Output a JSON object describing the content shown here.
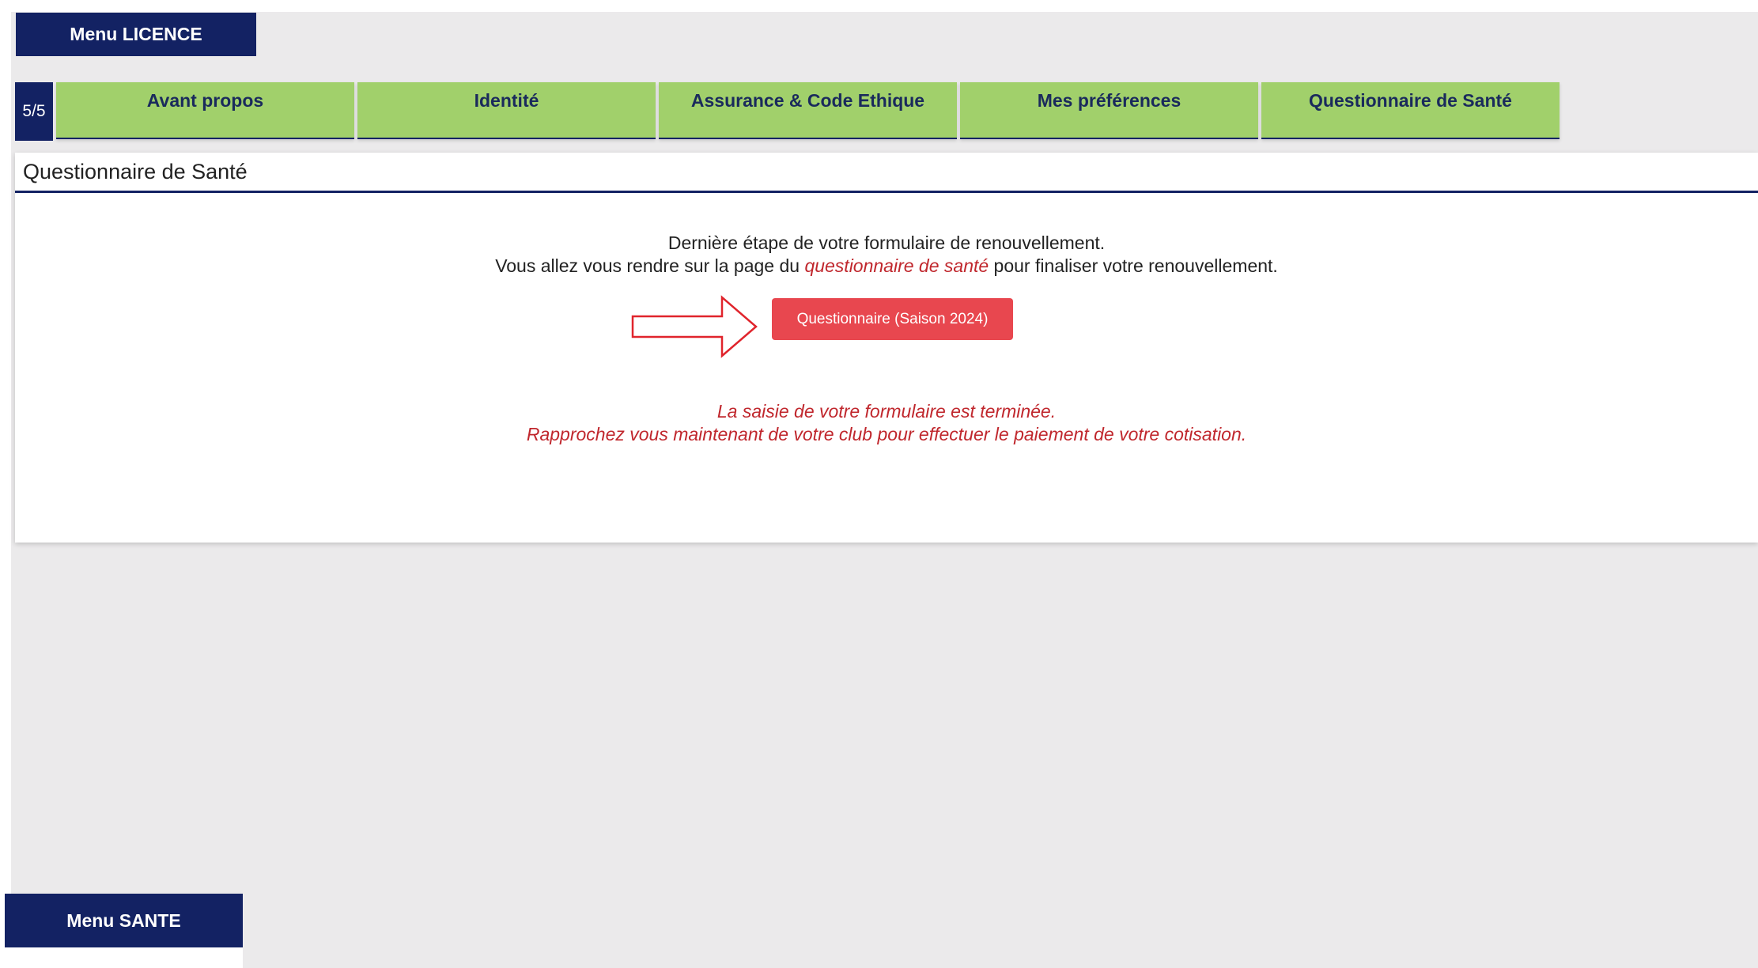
{
  "header": {
    "menu_licence": "Menu LICENCE"
  },
  "steps": {
    "counter": "5/5",
    "tabs": [
      {
        "label": "Avant propos"
      },
      {
        "label": "Identité"
      },
      {
        "label": "Assurance & Code Ethique"
      },
      {
        "label": "Mes préférences"
      },
      {
        "label": "Questionnaire de Santé"
      }
    ]
  },
  "panel": {
    "title": "Questionnaire de Santé",
    "intro_line1": "Dernière étape de votre formulaire de renouvellement.",
    "intro_line2_before": "Vous allez vous rendre sur la page du ",
    "intro_line2_link": "questionnaire de santé",
    "intro_line2_after": " pour finaliser votre renouvellement.",
    "button_label": "Questionnaire (Saison 2024)",
    "done_line1": "La saisie de votre formulaire est terminée.",
    "done_line2": "Rapprochez vous maintenant de votre club pour effectuer le paiement de votre cotisation."
  },
  "footer": {
    "menu_sante": "Menu SANTE"
  },
  "colors": {
    "navy": "#132263",
    "tab_green": "#a1d06b",
    "button_red": "#e8474f",
    "text_red": "#c0272d",
    "background": "#ebeaeb"
  },
  "icons": {
    "arrow": "arrow-right-outline-icon"
  }
}
